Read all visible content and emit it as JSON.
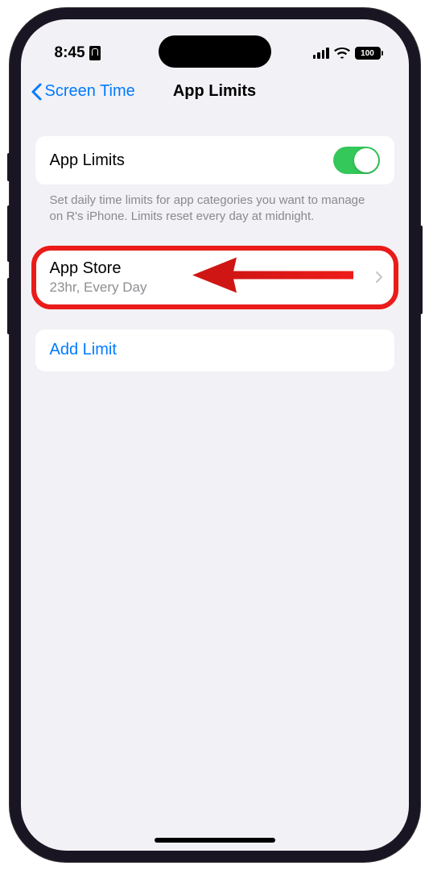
{
  "status": {
    "time": "8:45",
    "battery": "100"
  },
  "nav": {
    "back": "Screen Time",
    "title": "App Limits"
  },
  "toggle_section": {
    "label": "App Limits",
    "footer": "Set daily time limits for app categories you want to manage on R's iPhone. Limits reset every day at midnight."
  },
  "limit": {
    "title": "App Store",
    "subtitle": "23hr, Every Day"
  },
  "add": {
    "label": "Add Limit"
  }
}
